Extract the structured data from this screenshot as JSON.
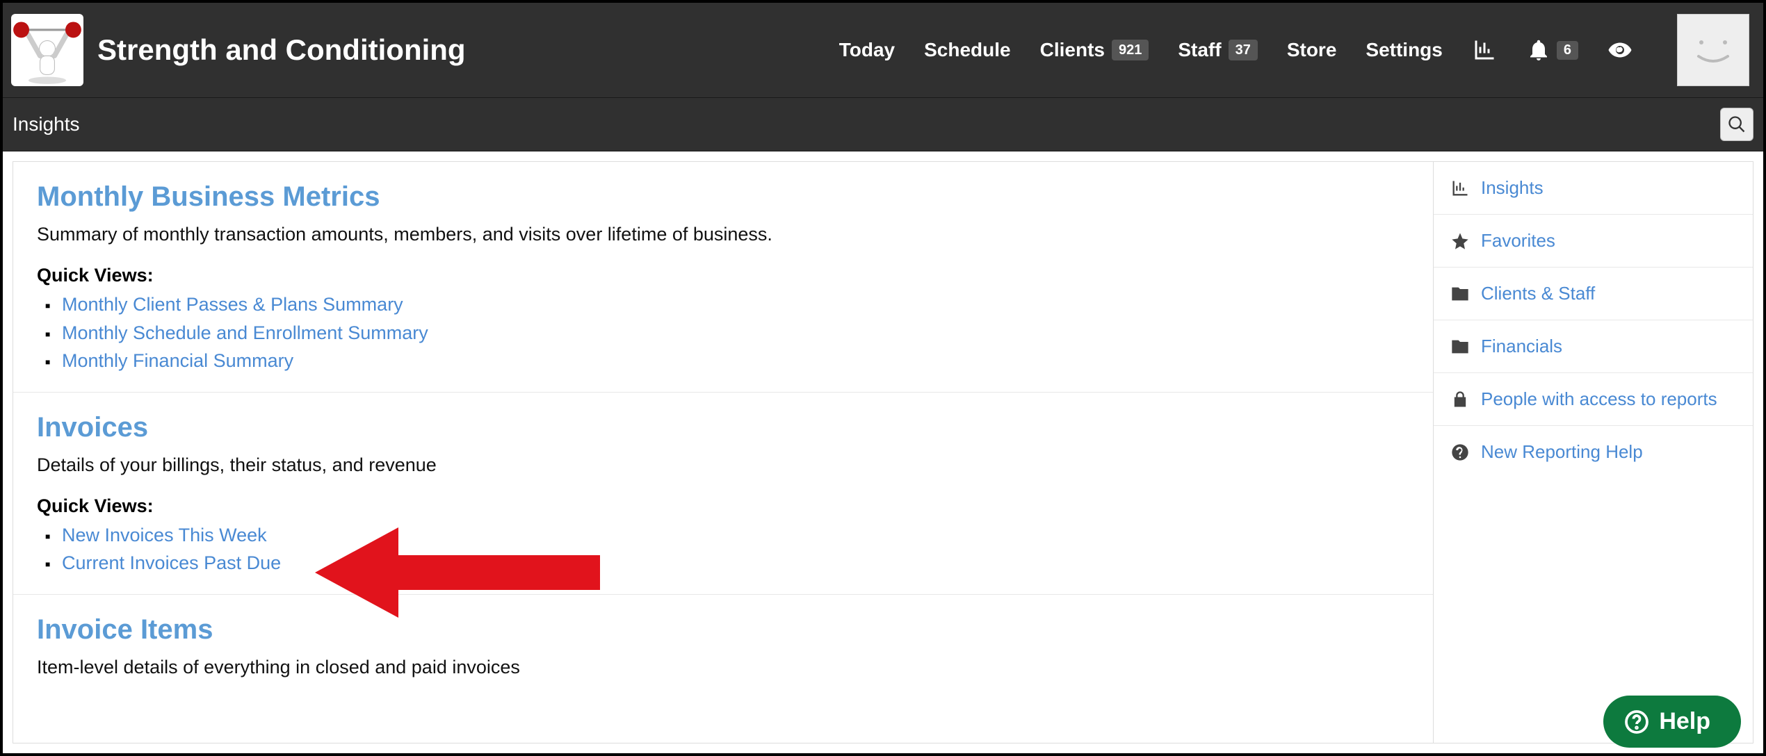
{
  "header": {
    "app_title": "Strength and Conditioning",
    "nav": {
      "today": "Today",
      "schedule": "Schedule",
      "clients": "Clients",
      "clients_count": "921",
      "staff": "Staff",
      "staff_count": "37",
      "store": "Store",
      "settings": "Settings",
      "notif_count": "6"
    }
  },
  "subbar": {
    "title": "Insights"
  },
  "sections": [
    {
      "title": "Monthly Business Metrics",
      "desc": "Summary of monthly transaction amounts, members, and visits over lifetime of business.",
      "qv_label": "Quick Views:",
      "links": [
        "Monthly Client Passes & Plans Summary",
        "Monthly Schedule and Enrollment Summary",
        "Monthly Financial Summary"
      ]
    },
    {
      "title": "Invoices",
      "desc": "Details of your billings, their status, and revenue",
      "qv_label": "Quick Views:",
      "links": [
        "New Invoices This Week",
        "Current Invoices Past Due"
      ]
    },
    {
      "title": "Invoice Items",
      "desc": "Item-level details of everything in closed and paid invoices",
      "qv_label": "",
      "links": []
    }
  ],
  "sidebar": [
    {
      "icon": "chart",
      "label": "Insights"
    },
    {
      "icon": "star",
      "label": "Favorites"
    },
    {
      "icon": "folder",
      "label": "Clients & Staff"
    },
    {
      "icon": "folder",
      "label": "Financials"
    },
    {
      "icon": "lock",
      "label": "People with access to reports"
    },
    {
      "icon": "question",
      "label": "New Reporting Help"
    }
  ],
  "help": {
    "label": "Help"
  }
}
